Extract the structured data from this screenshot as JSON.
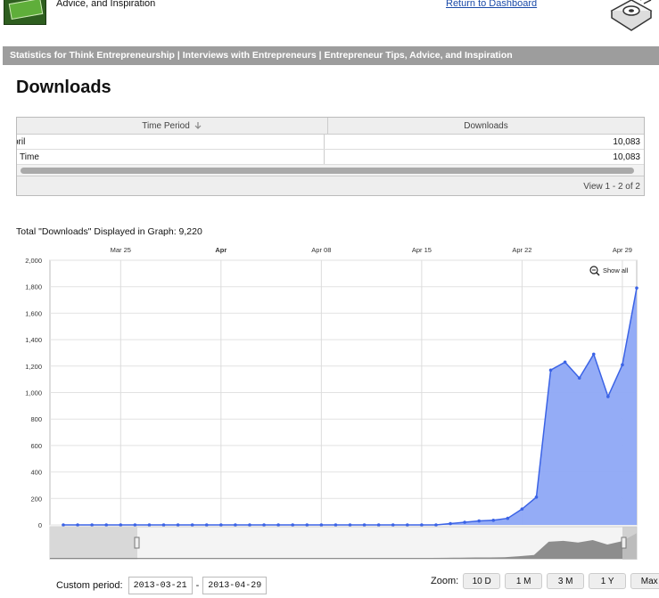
{
  "header": {
    "tagline": "Advice, and Inspiration",
    "dashboard_link": "Return to Dashboard",
    "stats_title": "Statistics for Think Entrepreneurship | Interviews with Entrepreneurs | Entrepreneur Tips, Advice, and Inspiration"
  },
  "page_title": "Downloads",
  "grid": {
    "col_period": "Time Period",
    "col_downloads": "Downloads",
    "rows": [
      {
        "period": "pril",
        "downloads": "10,083"
      },
      {
        "period": "ll Time",
        "downloads": "10,083"
      }
    ],
    "footer": "View 1 - 2 of 2"
  },
  "total_label": "Total \"Downloads\" Displayed in Graph: 9,220",
  "chart_data": {
    "type": "area",
    "title": "",
    "xlabel": "",
    "ylabel": "",
    "ylim": [
      0,
      2000
    ],
    "yticks": [
      "2,000",
      "1,800",
      "1,600",
      "1,400",
      "1,200",
      "1,000",
      "800",
      "600",
      "400",
      "200",
      "0"
    ],
    "xticks": [
      {
        "label": "Mar 25",
        "day": 4,
        "bold": false
      },
      {
        "label": "Apr",
        "day": 11,
        "bold": true
      },
      {
        "label": "Apr 08",
        "day": 18,
        "bold": false
      },
      {
        "label": "Apr 15",
        "day": 25,
        "bold": false
      },
      {
        "label": "Apr 22",
        "day": 32,
        "bold": false
      },
      {
        "label": "Apr 29",
        "day": 39,
        "bold": false
      }
    ],
    "start_label": "2013-03-21",
    "values": [
      0,
      0,
      0,
      0,
      0,
      0,
      0,
      0,
      0,
      0,
      0,
      0,
      0,
      0,
      0,
      0,
      0,
      0,
      0,
      0,
      0,
      0,
      0,
      0,
      0,
      0,
      0,
      10,
      20,
      30,
      35,
      50,
      120,
      210,
      1170,
      1230,
      1110,
      1290,
      970,
      1210,
      1790
    ],
    "fill_color": "#8ea8f6",
    "line_color": "#3b63e6",
    "show_all": "Show all",
    "grid": true
  },
  "controls": {
    "custom_label": "Custom period:",
    "from": "2013-03-21",
    "dash": "-",
    "to": "2013-04-29",
    "zoom_label": "Zoom:",
    "zoom_buttons": [
      "10 D",
      "1 M",
      "3 M",
      "1 Y",
      "Max"
    ]
  }
}
